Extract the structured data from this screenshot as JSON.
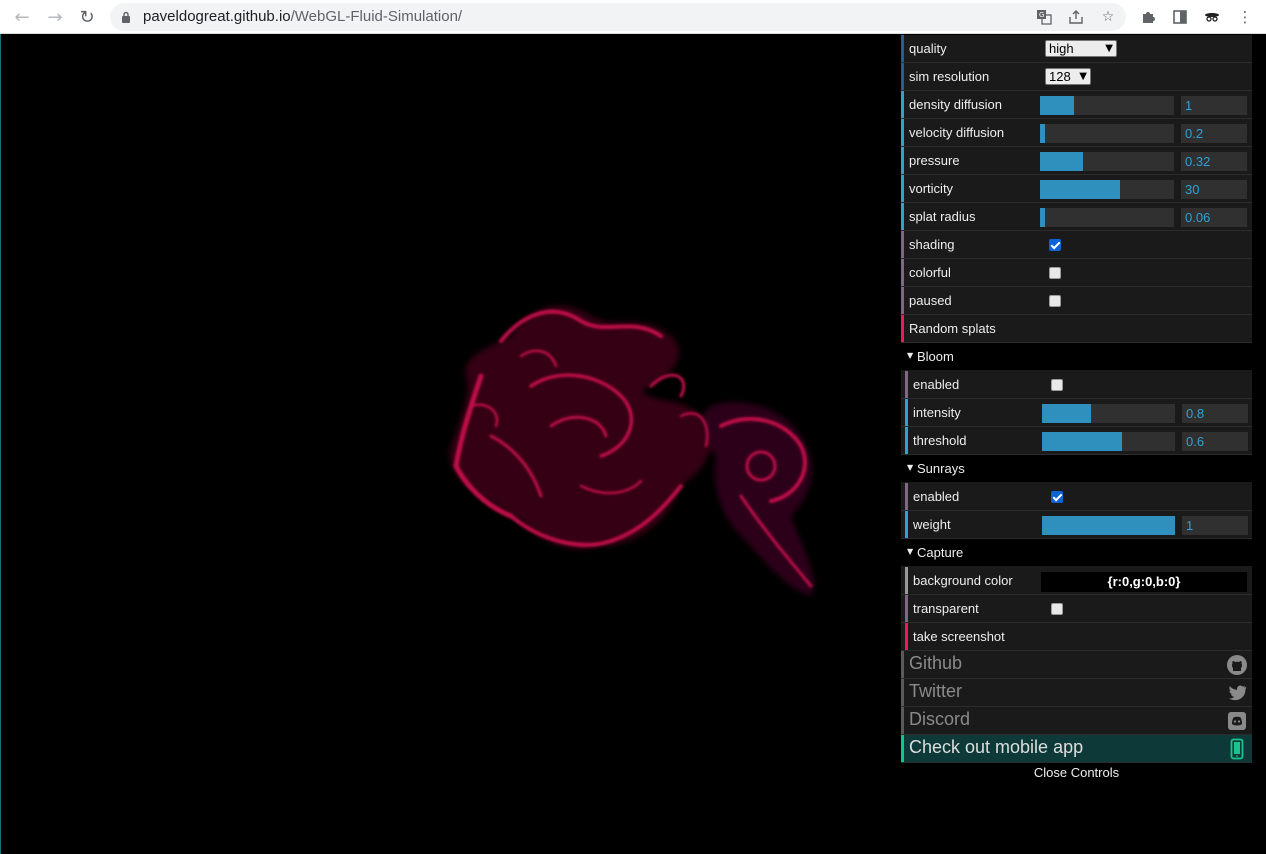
{
  "browser": {
    "url_host": "paveldogreat.github.io",
    "url_path": "/WebGL-Fluid-Simulation/"
  },
  "gui": {
    "quality": {
      "label": "quality",
      "value": "high"
    },
    "sim_resolution": {
      "label": "sim resolution",
      "value": "128"
    },
    "density_diffusion": {
      "label": "density diffusion",
      "value": "1",
      "fill": 0.25
    },
    "velocity_diffusion": {
      "label": "velocity diffusion",
      "value": "0.2",
      "fill": 0.04
    },
    "pressure": {
      "label": "pressure",
      "value": "0.32",
      "fill": 0.32
    },
    "vorticity": {
      "label": "vorticity",
      "value": "30",
      "fill": 0.6
    },
    "splat_radius": {
      "label": "splat radius",
      "value": "0.06",
      "fill": 0.04
    },
    "shading": {
      "label": "shading",
      "checked": true
    },
    "colorful": {
      "label": "colorful",
      "checked": false
    },
    "paused": {
      "label": "paused",
      "checked": false
    },
    "random_splats": {
      "label": "Random splats"
    },
    "bloom": {
      "title": "Bloom",
      "enabled": {
        "label": "enabled",
        "checked": false
      },
      "intensity": {
        "label": "intensity",
        "value": "0.8",
        "fill": 0.37
      },
      "threshold": {
        "label": "threshold",
        "value": "0.6",
        "fill": 0.6
      }
    },
    "sunrays": {
      "title": "Sunrays",
      "enabled": {
        "label": "enabled",
        "checked": true
      },
      "weight": {
        "label": "weight",
        "value": "1",
        "fill": 1.0
      }
    },
    "capture": {
      "title": "Capture",
      "background_color": {
        "label": "background color",
        "value": "{r:0,g:0,b:0}"
      },
      "transparent": {
        "label": "transparent",
        "checked": false
      },
      "take_screenshot": {
        "label": "take screenshot"
      }
    },
    "links": {
      "github": "Github",
      "twitter": "Twitter",
      "discord": "Discord",
      "mobile_app": "Check out mobile app"
    },
    "close_controls": "Close Controls"
  },
  "colors": {
    "accent_blue": "#2fa1d6",
    "fluid": "#c2104a",
    "app_green": "#19c48c"
  }
}
